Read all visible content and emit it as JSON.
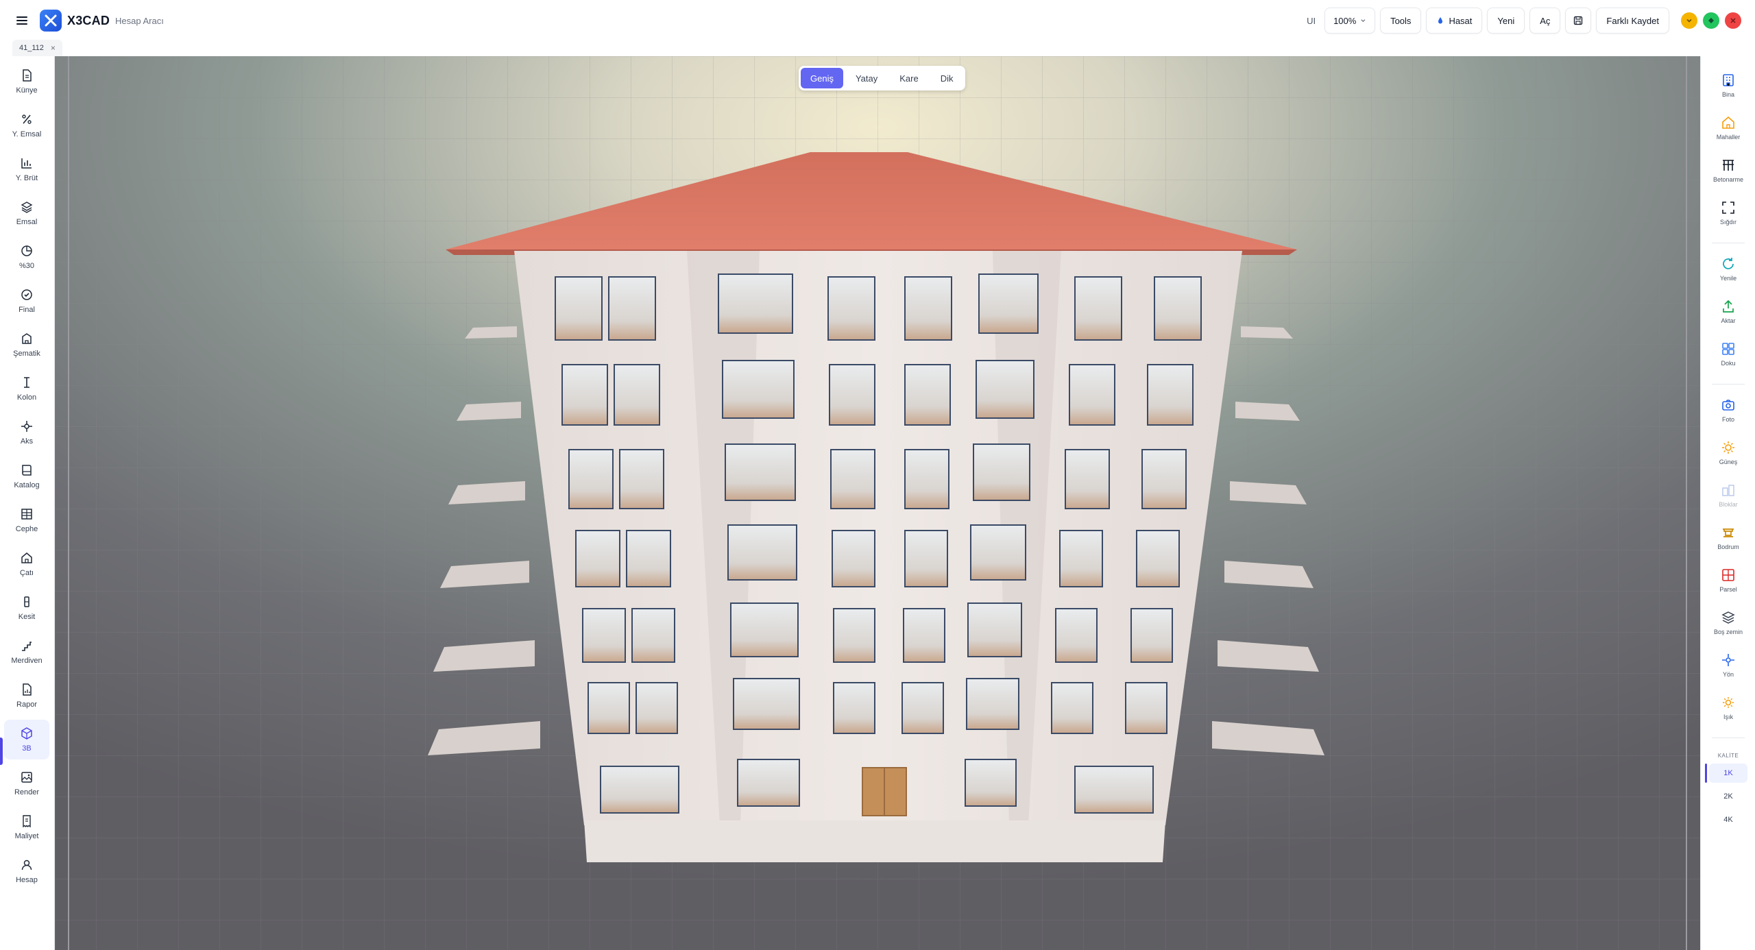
{
  "app": {
    "brand": "X3CAD",
    "subtitle": "Hesap Aracı"
  },
  "topbar": {
    "ui_label": "UI",
    "zoom_value": "100%",
    "tools_label": "Tools",
    "hasat_label": "Hasat",
    "new_label": "Yeni",
    "open_label": "Aç",
    "save_as_label": "Farklı Kaydet"
  },
  "tabs": [
    {
      "label": "41_112"
    }
  ],
  "left_sidebar": {
    "items": [
      {
        "label": "Künye",
        "icon": "document-icon"
      },
      {
        "label": "Y. Emsal",
        "icon": "percent-icon"
      },
      {
        "label": "Y. Brüt",
        "icon": "bar-chart-icon"
      },
      {
        "label": "Emsal",
        "icon": "layers-icon"
      },
      {
        "label": "%30",
        "icon": "pie-icon"
      },
      {
        "label": "Final",
        "icon": "check-circle-icon"
      },
      {
        "label": "Şematik",
        "icon": "building-icon"
      },
      {
        "label": "Kolon",
        "icon": "column-icon"
      },
      {
        "label": "Aks",
        "icon": "axis-icon"
      },
      {
        "label": "Katalog",
        "icon": "book-icon"
      },
      {
        "label": "Cephe",
        "icon": "facade-icon"
      },
      {
        "label": "Çatı",
        "icon": "home-icon"
      },
      {
        "label": "Kesit",
        "icon": "section-icon"
      },
      {
        "label": "Merdiven",
        "icon": "stairs-icon"
      },
      {
        "label": "Rapor",
        "icon": "report-icon"
      },
      {
        "label": "3B",
        "icon": "cube-icon",
        "active": true
      },
      {
        "label": "Render",
        "icon": "image-icon"
      },
      {
        "label": "Maliyet",
        "icon": "receipt-icon"
      },
      {
        "label": "Hesap",
        "icon": "user-icon"
      }
    ]
  },
  "view_modes": {
    "selected": "Geniş",
    "options": [
      "Geniş",
      "Yatay",
      "Kare",
      "Dik"
    ]
  },
  "right_sidebar": {
    "items": [
      {
        "label": "Bina",
        "icon": "building-icon"
      },
      {
        "label": "Mahaller",
        "icon": "house-icon"
      },
      {
        "label": "Betonarme",
        "icon": "frame-icon"
      },
      {
        "label": "Sığdır",
        "icon": "fit-icon"
      },
      {
        "label": "Yenile",
        "icon": "refresh-icon"
      },
      {
        "label": "Aktar",
        "icon": "export-icon"
      },
      {
        "label": "Doku",
        "icon": "grid-icon"
      },
      {
        "label": "Foto",
        "icon": "camera-icon"
      },
      {
        "label": "Güneş",
        "icon": "sun-icon"
      },
      {
        "label": "Bloklar",
        "icon": "blocks-icon",
        "disabled": true
      },
      {
        "label": "Bodrum",
        "icon": "basement-icon"
      },
      {
        "label": "Parsel",
        "icon": "parcel-icon"
      },
      {
        "label": "Boş zemin",
        "icon": "ground-icon"
      },
      {
        "label": "Yön",
        "icon": "compass-icon"
      },
      {
        "label": "Işık",
        "icon": "light-icon"
      }
    ],
    "quality_label": "KALİTE",
    "quality_options": [
      "1K",
      "2K",
      "4K"
    ],
    "quality_selected": "1K"
  },
  "colors": {
    "accent": "#6366f1",
    "roof": "#d9705f",
    "wall": "#e8e2df",
    "ground": "#6b6a70",
    "win_minimize": "#f5b400",
    "win_maximize": "#22c55e",
    "win_close": "#ef4444"
  }
}
